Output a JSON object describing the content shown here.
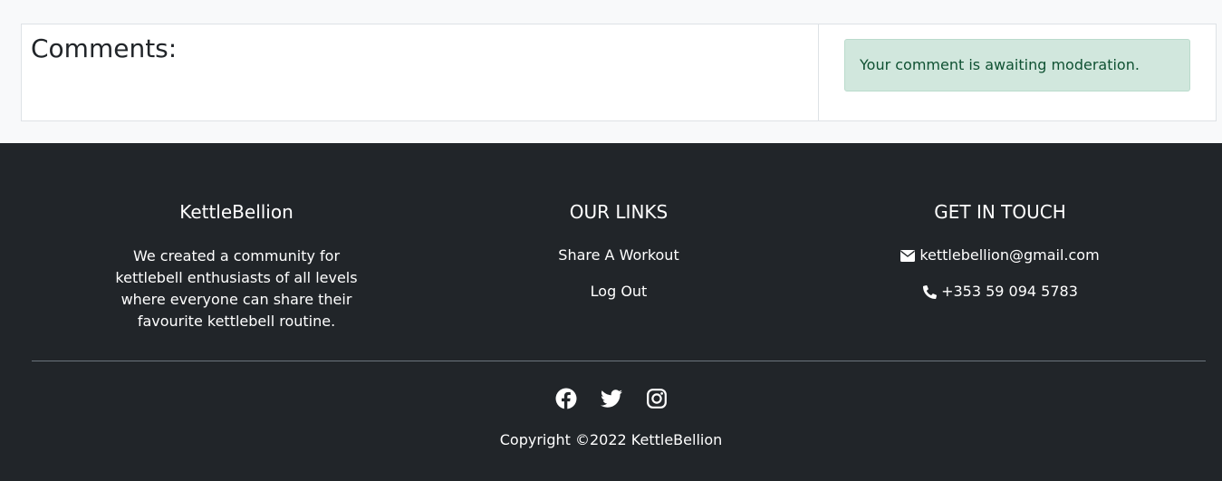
{
  "comments": {
    "title": "Comments:"
  },
  "moderation": {
    "message": "Your comment is awaiting moderation."
  },
  "footer": {
    "about": {
      "heading": "KettleBellion",
      "text": "We created a community for kettlebell enthusiasts of all levels where everyone can share their favourite kettlebell routine."
    },
    "links": {
      "heading": "OUR LINKS",
      "items": [
        {
          "label": "Share A Workout"
        },
        {
          "label": "Log Out"
        }
      ]
    },
    "contact": {
      "heading": "GET IN TOUCH",
      "email": "kettlebellion@gmail.com",
      "phone": "+353 59 094 5783",
      "email_icon": "envelope-icon",
      "phone_icon": "phone-icon"
    },
    "social": [
      {
        "icon": "facebook-icon"
      },
      {
        "icon": "twitter-icon"
      },
      {
        "icon": "instagram-icon"
      }
    ],
    "copyright": "Copyright ©2022 KettleBellion"
  },
  "colors": {
    "page_bg": "#f8f9fa",
    "footer_bg": "#212529",
    "alert_bg": "#d1e7dd",
    "alert_text": "#0f5132"
  }
}
